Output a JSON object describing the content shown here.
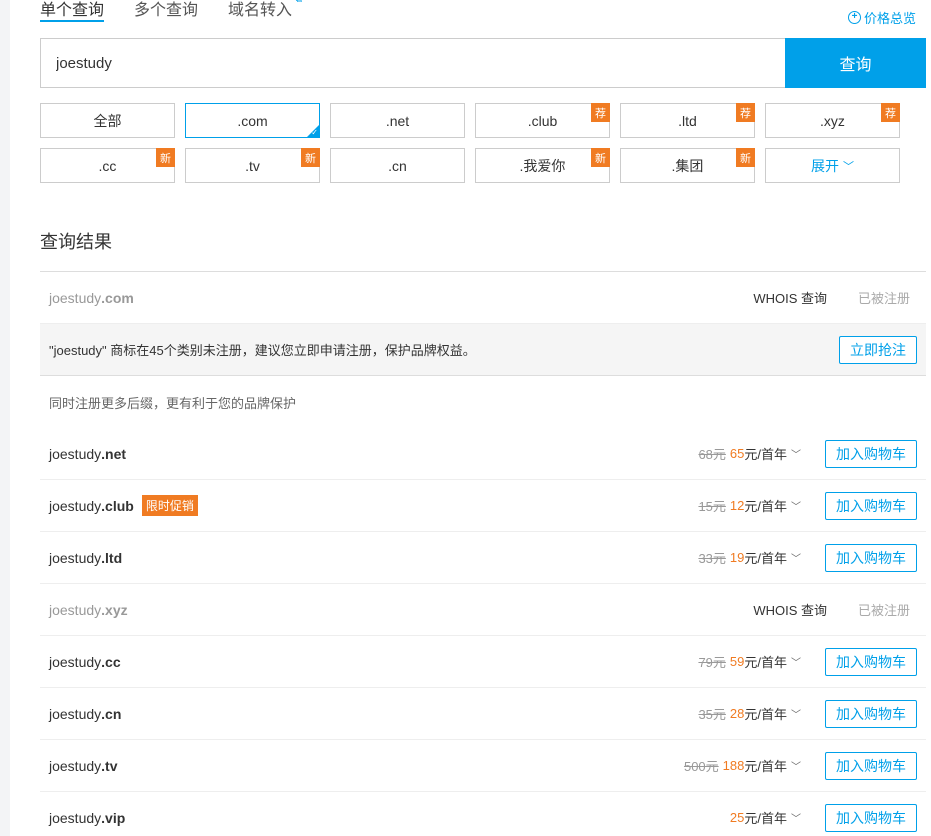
{
  "tabs": [
    {
      "label": "单个查询"
    },
    {
      "label": "多个查询"
    },
    {
      "label": "域名转入"
    }
  ],
  "price_overview": "价格总览",
  "search": {
    "value": "joestudy",
    "button": "查询"
  },
  "suffixes": {
    "row1": [
      {
        "label": "全部",
        "badge": ""
      },
      {
        "label": ".com",
        "badge": ""
      },
      {
        "label": ".net",
        "badge": ""
      },
      {
        "label": ".club",
        "badge": "荐"
      },
      {
        "label": ".ltd",
        "badge": "荐"
      },
      {
        "label": ".xyz",
        "badge": "荐"
      }
    ],
    "row2": [
      {
        "label": ".cc",
        "badge": "新"
      },
      {
        "label": ".tv",
        "badge": "新"
      },
      {
        "label": ".cn",
        "badge": ""
      },
      {
        "label": ".我爱你",
        "badge": "新"
      },
      {
        "label": ".集团",
        "badge": "新"
      },
      {
        "label": "展开",
        "badge": ""
      }
    ]
  },
  "results": {
    "title": "查询结果",
    "primary": {
      "name": "joestudy",
      "suffix": ".com",
      "whois": "WHOIS 查询",
      "status": "已被注册"
    },
    "notice": {
      "text": "\"joestudy\" 商标在45个类别未注册，建议您立即申请注册，保护品牌权益。",
      "button": "立即抢注"
    },
    "hint": "同时注册更多后缀，更有利于您的品牌保护",
    "cart_label": "加入购物车",
    "rows": [
      {
        "name": "joestudy",
        "suffix": ".net",
        "old": "68元",
        "new": "65",
        "unit": "元/首年",
        "promo": ""
      },
      {
        "name": "joestudy",
        "suffix": ".club",
        "old": "15元",
        "new": "12",
        "unit": "元/首年",
        "promo": "限时促销"
      },
      {
        "name": "joestudy",
        "suffix": ".ltd",
        "old": "33元",
        "new": "19",
        "unit": "元/首年",
        "promo": ""
      },
      {
        "name": "joestudy",
        "suffix": ".xyz",
        "taken": true,
        "whois": "WHOIS 查询",
        "status": "已被注册"
      },
      {
        "name": "joestudy",
        "suffix": ".cc",
        "old": "79元",
        "new": "59",
        "unit": "元/首年",
        "promo": ""
      },
      {
        "name": "joestudy",
        "suffix": ".cn",
        "old": "35元",
        "new": "28",
        "unit": "元/首年",
        "promo": ""
      },
      {
        "name": "joestudy",
        "suffix": ".tv",
        "old": "500元",
        "new": "188",
        "unit": "元/首年",
        "promo": ""
      },
      {
        "name": "joestudy",
        "suffix": ".vip",
        "old": "",
        "new": "25",
        "unit": "元/首年",
        "promo": ""
      }
    ]
  },
  "colors": {
    "accent": "#00a0e9",
    "badge": "#f07b22"
  }
}
